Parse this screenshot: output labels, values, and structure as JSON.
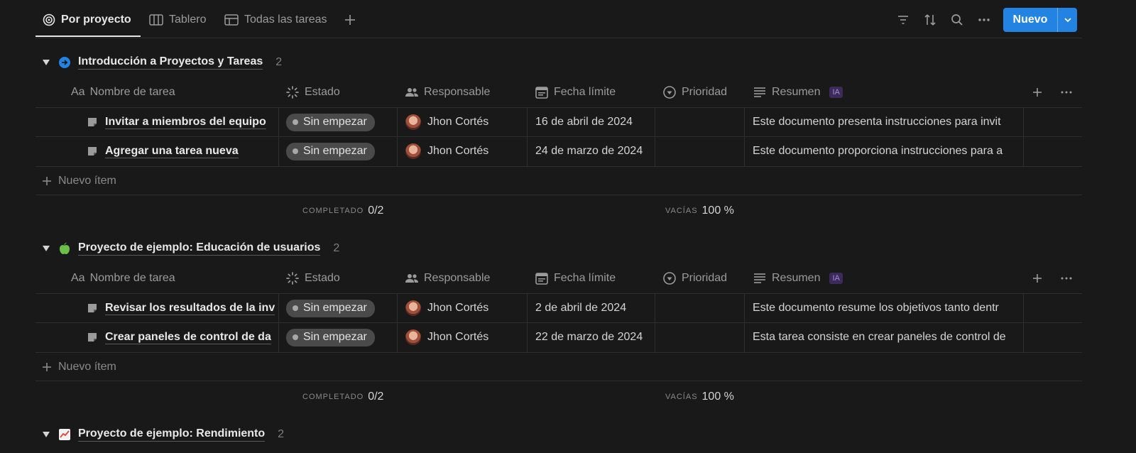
{
  "tabs": [
    {
      "label": "Por proyecto",
      "icon": "target-icon"
    },
    {
      "label": "Tablero",
      "icon": "board-icon"
    },
    {
      "label": "Todas las tareas",
      "icon": "table-icon"
    }
  ],
  "toolbar": {
    "new_label": "Nuevo"
  },
  "columns": {
    "name": "Nombre de tarea",
    "name_prefix": "Aa",
    "status": "Estado",
    "assignee": "Responsable",
    "due": "Fecha límite",
    "priority": "Prioridad",
    "summary": "Resumen",
    "summary_badge": "IA"
  },
  "groups": [
    {
      "title": "Introducción a Proyectos y Tareas",
      "count": "2",
      "icon": "arrow-circle-icon",
      "rows": [
        {
          "name": "Invitar a miembros del equipo",
          "status": "Sin empezar",
          "assignee": "Jhon Cortés",
          "due": "16 de abril de 2024",
          "priority": "",
          "summary": "Este documento presenta instrucciones para invit"
        },
        {
          "name": "Agregar una tarea nueva",
          "status": "Sin empezar",
          "assignee": "Jhon Cortés",
          "due": "24 de marzo de 2024",
          "priority": "",
          "summary": "Este documento proporciona instrucciones para a"
        }
      ],
      "new_item": "Nuevo ítem",
      "calc_completed_label": "COMPLETADO",
      "calc_completed_value": "0/2",
      "calc_empty_label": "VACÍAS",
      "calc_empty_value": "100 %"
    },
    {
      "title": "Proyecto de ejemplo: Educación de usuarios",
      "count": "2",
      "icon": "apple-icon",
      "rows": [
        {
          "name": "Revisar los resultados de la inv",
          "status": "Sin empezar",
          "assignee": "Jhon Cortés",
          "due": "2 de abril de 2024",
          "priority": "",
          "summary": "Este documento resume los objetivos tanto dentr"
        },
        {
          "name": "Crear paneles de control de da",
          "status": "Sin empezar",
          "assignee": "Jhon Cortés",
          "due": "22 de marzo de 2024",
          "priority": "",
          "summary": "Esta tarea consiste en crear paneles de control de"
        }
      ],
      "new_item": "Nuevo ítem",
      "calc_completed_label": "COMPLETADO",
      "calc_completed_value": "0/2",
      "calc_empty_label": "VACÍAS",
      "calc_empty_value": "100 %"
    },
    {
      "title": "Proyecto de ejemplo: Rendimiento",
      "count": "2",
      "icon": "chart-up-icon"
    }
  ]
}
